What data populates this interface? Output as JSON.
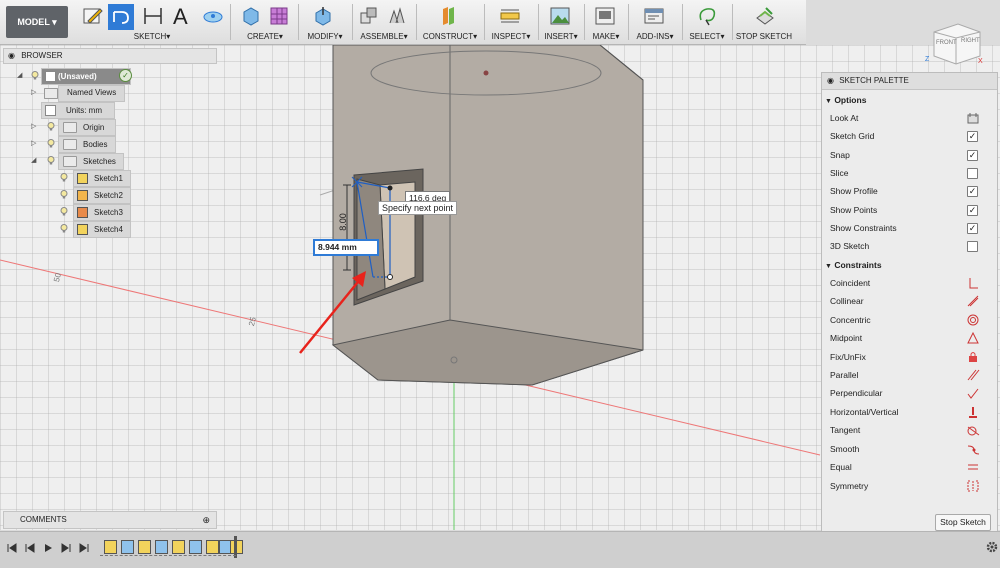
{
  "toolbar": {
    "model": "MODEL",
    "sketch": "SKETCH",
    "create": "CREATE",
    "modify": "MODIFY",
    "assemble": "ASSEMBLE",
    "construct": "CONSTRUCT",
    "inspect": "INSPECT",
    "insert": "INSERT",
    "make": "MAKE",
    "addins": "ADD-INS",
    "select": "SELECT",
    "stop": "STOP SKETCH",
    "dropdown_icon": "triangle-down",
    "accent": "#2f7bd6"
  },
  "browser": {
    "title": "BROWSER",
    "items": [
      {
        "label": "(Unsaved)"
      },
      {
        "label": "Named Views"
      },
      {
        "label": "Units: mm"
      },
      {
        "label": "Origin"
      },
      {
        "label": "Bodies"
      },
      {
        "label": "Sketches"
      },
      {
        "label": "Sketch1"
      },
      {
        "label": "Sketch2"
      },
      {
        "label": "Sketch3"
      },
      {
        "label": "Sketch4"
      }
    ]
  },
  "comments": {
    "title": "COMMENTS"
  },
  "viewcube": {
    "front": "FRONT",
    "right": "RIGHT",
    "axis_z": "Z",
    "axis_x": "X"
  },
  "viewport": {
    "tooltip": "Specify next point",
    "angle": "116.6 deg",
    "length": "8.944 mm",
    "vertical_dim": "8.00",
    "ruler_a": "50",
    "ruler_b": "25",
    "arrow_color": "#e8231c"
  },
  "palette": {
    "title": "SKETCH PALETTE",
    "options_label": "Options",
    "options": [
      {
        "label": "Look At"
      },
      {
        "label": "Sketch Grid"
      },
      {
        "label": "Snap"
      },
      {
        "label": "Slice"
      },
      {
        "label": "Show Profile"
      },
      {
        "label": "Show Points"
      },
      {
        "label": "Show Constraints"
      },
      {
        "label": "3D Sketch"
      }
    ],
    "constraints_label": "Constraints",
    "constraints": [
      {
        "label": "Coincident"
      },
      {
        "label": "Collinear"
      },
      {
        "label": "Concentric"
      },
      {
        "label": "Midpoint"
      },
      {
        "label": "Fix/UnFix"
      },
      {
        "label": "Parallel"
      },
      {
        "label": "Perpendicular"
      },
      {
        "label": "Horizontal/Vertical"
      },
      {
        "label": "Tangent"
      },
      {
        "label": "Smooth"
      },
      {
        "label": "Equal"
      },
      {
        "label": "Symmetry"
      }
    ],
    "stop_button": "Stop Sketch"
  }
}
